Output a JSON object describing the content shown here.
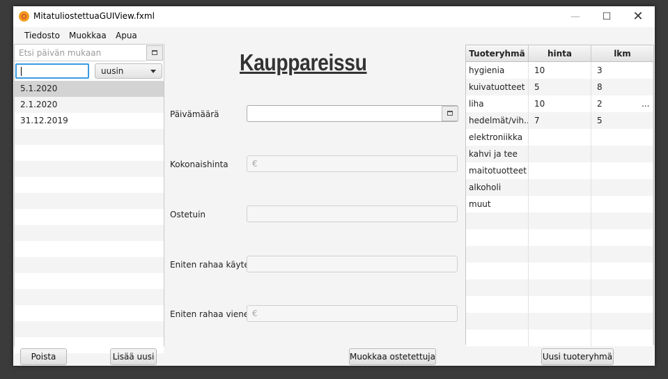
{
  "window": {
    "title": "MitatuliostettuaGUIView.fxml"
  },
  "menu": [
    "Tiedosto",
    "Muokkaa",
    "Apua"
  ],
  "left": {
    "search_placeholder": "Etsi päivän mukaan",
    "filter_value": "",
    "sort_selected": "uusin",
    "dates": [
      "5.1.2020",
      "2.1.2020",
      "31.12.2019"
    ],
    "selected_index": 0,
    "delete_label": "Poista",
    "add_label": "Lisää uusi"
  },
  "center": {
    "title": "Kauppareissu",
    "fields": [
      {
        "label": "Päivämäärä",
        "placeholder": ""
      },
      {
        "label": "Kokonaishinta",
        "placeholder": "€"
      },
      {
        "label": "Ostetuin",
        "placeholder": ""
      },
      {
        "label": "Eniten rahaa käyte...",
        "placeholder": "€"
      },
      {
        "label": "Eniten rahaa viene...",
        "placeholder": "€"
      }
    ],
    "edit_label": "Muokkaa ostetettuja"
  },
  "table": {
    "headers": [
      "Tuoteryhmä",
      "hinta",
      "lkm"
    ],
    "rows": [
      [
        "hygienia",
        "10",
        "3"
      ],
      [
        "kuivatuotteet",
        "5",
        "8"
      ],
      [
        "liha",
        "10",
        "2"
      ],
      [
        "hedelmät/vih...",
        "7",
        "5"
      ],
      [
        "elektroniikka",
        "",
        ""
      ],
      [
        "kahvi ja tee",
        "",
        ""
      ],
      [
        "maitotuotteet",
        "",
        ""
      ],
      [
        "alkoholi",
        "",
        ""
      ],
      [
        "muut",
        "",
        ""
      ]
    ],
    "overflow_mark": "...",
    "new_group_label": "Uusi tuoteryhmä"
  },
  "colors": {
    "focus": "#3a9be0",
    "selected_row": "#d3d3d3",
    "stripe": "#f4f4f4"
  }
}
